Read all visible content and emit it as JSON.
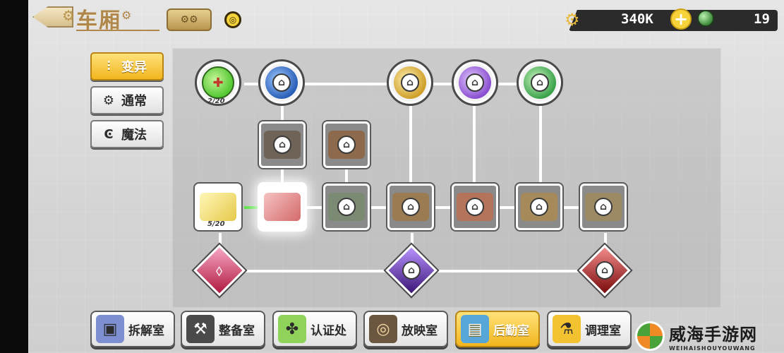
{
  "header": {
    "title": "车厢",
    "currency_amount": "340K",
    "gem_amount": "19"
  },
  "side_tabs": [
    {
      "label": "变异",
      "icon": "mutation-icon",
      "active": true
    },
    {
      "label": "通常",
      "icon": "gear-icon",
      "active": false
    },
    {
      "label": "魔法",
      "icon": "magic-icon",
      "active": false
    }
  ],
  "tree": {
    "potion_progress": "2/20",
    "cheese_progress": "5/20"
  },
  "bottom_nav": [
    {
      "label": "拆解室",
      "icon": "disassembly-icon",
      "active": false
    },
    {
      "label": "整备室",
      "icon": "anvil-icon",
      "active": false
    },
    {
      "label": "认证处",
      "icon": "puzzle-icon",
      "active": false
    },
    {
      "label": "放映室",
      "icon": "projector-icon",
      "active": false
    },
    {
      "label": "后勤室",
      "icon": "logistics-icon",
      "active": true
    },
    {
      "label": "调理室",
      "icon": "cooking-icon",
      "active": false
    }
  ],
  "watermark": {
    "main": "威海手游网",
    "sub": "WEIHAISHOUYOUWANG"
  },
  "colors": {
    "accent": "#f2b61f",
    "connector_active": "#5fe24a"
  }
}
